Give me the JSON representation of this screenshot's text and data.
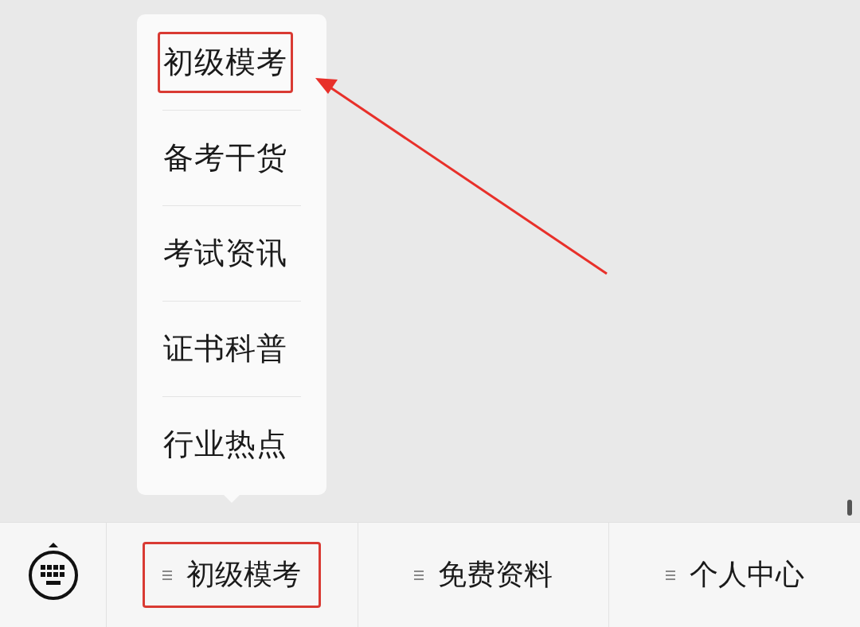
{
  "menu": {
    "items": [
      {
        "label": "初级模考",
        "highlighted": true
      },
      {
        "label": "备考干货",
        "highlighted": false
      },
      {
        "label": "考试资讯",
        "highlighted": false
      },
      {
        "label": "证书科普",
        "highlighted": false
      },
      {
        "label": "行业热点",
        "highlighted": false
      }
    ]
  },
  "annotation": {
    "arrow": true
  },
  "bottom_bar": {
    "tabs": [
      {
        "label": "初级模考",
        "highlighted": true
      },
      {
        "label": "免费资料",
        "highlighted": false
      },
      {
        "label": "个人中心",
        "highlighted": false
      }
    ]
  }
}
